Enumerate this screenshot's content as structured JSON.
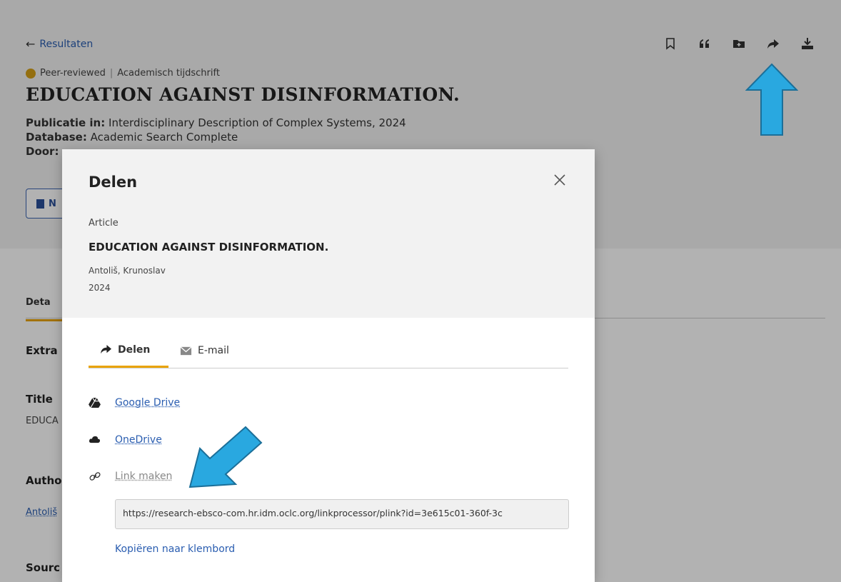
{
  "header": {
    "back_label": "Resultaten",
    "meta_peer": "Peer-reviewed",
    "meta_type": "Academisch tijdschrift",
    "title": "EDUCATION AGAINST DISINFORMATION.",
    "pub_label": "Publicatie in:",
    "pub_value": "Interdisciplinary Description of Complex Systems, 2024",
    "db_label": "Database:",
    "db_value": "Academic Search Complete",
    "by_label": "Door:",
    "pdf_label": "N"
  },
  "toolbar": {
    "icons": [
      "bookmark-icon",
      "quote-icon",
      "add-folder-icon",
      "share-icon",
      "download-icon"
    ]
  },
  "background": {
    "tab_details": "Deta",
    "extra": "Extra",
    "title_head": "Title",
    "title_val": "EDUCA",
    "author_head": "Autho",
    "author_val": "Antoliš",
    "source_head": "Sourc"
  },
  "modal": {
    "title": "Delen",
    "doc_type": "Article",
    "doc_title": "EDUCATION AGAINST DISINFORMATION.",
    "doc_author": "Antoliš, Krunoslav",
    "doc_year": "2024",
    "tabs": [
      {
        "label": "Delen",
        "icon": "share-icon",
        "active": true
      },
      {
        "label": "E-mail",
        "icon": "envelope-icon",
        "active": false
      }
    ],
    "share_options": [
      {
        "label": "Google Drive",
        "icon": "google-drive-icon"
      },
      {
        "label": "OneDrive",
        "icon": "cloud-icon"
      },
      {
        "label": "Link maken",
        "icon": "link-icon"
      }
    ],
    "url_value": "https://research-ebsco-com.hr.idm.oclc.org/linkprocessor/plink?id=3e615c01-360f-3c",
    "copy_label": "Kopiëren naar klembord"
  },
  "colors": {
    "accent": "#e9a300",
    "link": "#2a5db0",
    "annotation_arrow": "#29a8e0"
  }
}
